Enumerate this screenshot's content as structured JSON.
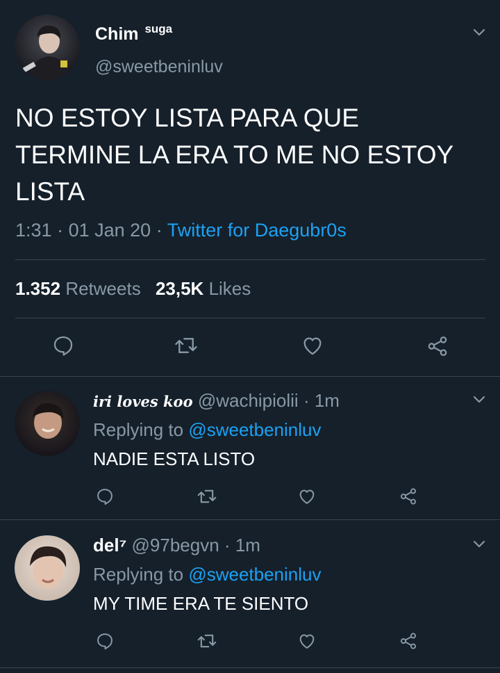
{
  "main_tweet": {
    "display_name": "Chim",
    "name_suffix": "suga",
    "handle": "@sweetbeninluv",
    "text_lines": [
      "NO ESTOY LISTA PARA QUE",
      "TERMINE LA ERA TO ME NO ESTOY",
      "LISTA"
    ],
    "time": "1:31",
    "date": "01 Jan 20",
    "source": "Twitter for Daegubr0s",
    "retweets_count": "1.352",
    "retweets_label": "Retweets",
    "likes_count": "23,5K",
    "likes_label": "Likes"
  },
  "replies": [
    {
      "display_name": "𝒊𝒓𝒊 𝒍𝒐𝒗𝒆𝒔 𝒌𝒐𝒐",
      "handle": "@wachipiolii",
      "age": "1m",
      "replying_label": "Replying to",
      "replying_to": "@sweetbeninluv",
      "text": "NADIE ESTA LISTO"
    },
    {
      "display_name": "del⁷",
      "handle": "@97begvn",
      "age": "1m",
      "replying_label": "Replying to",
      "replying_to": "@sweetbeninluv",
      "text": "MY TIME ERA TE SIENTO"
    }
  ],
  "colors": {
    "background": "#15202b",
    "muted": "#8899a6",
    "link": "#1da1f2",
    "divider": "#38444d"
  },
  "icons": [
    "chevron-down-icon",
    "reply-icon",
    "retweet-icon",
    "like-icon",
    "share-icon"
  ]
}
